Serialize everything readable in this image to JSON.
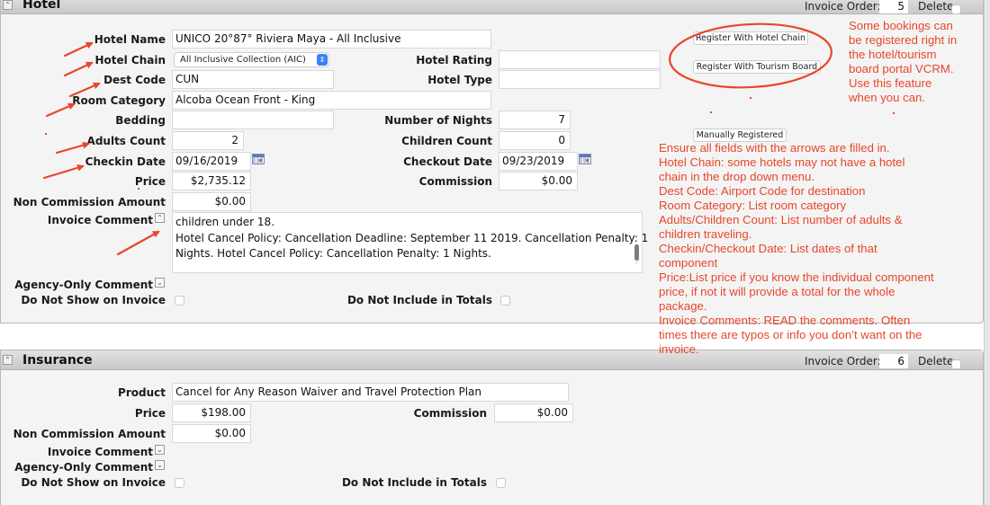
{
  "hotel": {
    "title": "Hotel",
    "invoice_order_label": "Invoice Order:",
    "invoice_order_value": "5",
    "delete_label": "Delete",
    "fields": {
      "hotel_name": {
        "label": "Hotel Name",
        "value": "UNICO 20°87° Riviera Maya - All Inclusive"
      },
      "hotel_chain": {
        "label": "Hotel Chain",
        "value": "All Inclusive Collection (AIC)"
      },
      "hotel_rating": {
        "label": "Hotel Rating",
        "value": ""
      },
      "dest_code": {
        "label": "Dest Code",
        "value": "CUN"
      },
      "hotel_type": {
        "label": "Hotel Type",
        "value": ""
      },
      "room_category": {
        "label": "Room Category",
        "value": "Alcoba Ocean Front - King"
      },
      "bedding": {
        "label": "Bedding",
        "value": ""
      },
      "number_of_nights": {
        "label": "Number of Nights",
        "value": "7"
      },
      "adults_count": {
        "label": "Adults Count",
        "value": "2"
      },
      "children_count": {
        "label": "Children Count",
        "value": "0"
      },
      "checkin_date": {
        "label": "Checkin Date",
        "value": "09/16/2019"
      },
      "checkout_date": {
        "label": "Checkout Date",
        "value": "09/23/2019"
      },
      "price": {
        "label": "Price",
        "value": "$2,735.12"
      },
      "commission": {
        "label": "Commission",
        "value": "$0.00"
      },
      "non_commission_amount": {
        "label": "Non Commission Amount",
        "value": "$0.00"
      },
      "invoice_comment": {
        "label": "Invoice Comment",
        "lines": [
          "children under 18.",
          "Hotel Cancel Policy: Cancellation Deadline: September 11 2019. Cancellation Penalty: 1",
          "Nights. Hotel Cancel Policy: Cancellation Penalty: 1 Nights."
        ]
      },
      "agency_only_comment": {
        "label": "Agency-Only Comment"
      },
      "do_not_show_on_invoice": {
        "label": "Do Not Show on Invoice",
        "checked": false
      },
      "do_not_include_in_totals": {
        "label": "Do Not Include in Totals",
        "checked": false
      }
    },
    "buttons": {
      "register_hotel_chain": "Register With Hotel Chain",
      "register_tourism_board": "Register With Tourism Board",
      "manually_registered": "Manually Registered"
    }
  },
  "insurance": {
    "title": "Insurance",
    "invoice_order_label": "Invoice Order:",
    "invoice_order_value": "6",
    "delete_label": "Delete",
    "fields": {
      "product": {
        "label": "Product",
        "value": "Cancel for Any Reason Waiver and Travel Protection Plan"
      },
      "price": {
        "label": "Price",
        "value": "$198.00"
      },
      "commission": {
        "label": "Commission",
        "value": "$0.00"
      },
      "non_commission_amount": {
        "label": "Non Commission Amount",
        "value": "$0.00"
      },
      "invoice_comment": {
        "label": "Invoice Comment"
      },
      "agency_only_comment": {
        "label": "Agency-Only Comment"
      },
      "do_not_show_on_invoice": {
        "label": "Do Not Show on Invoice",
        "checked": false
      },
      "do_not_include_in_totals": {
        "label": "Do Not Include in Totals",
        "checked": false
      }
    }
  },
  "annotations": {
    "color": "#e8462a",
    "registration_note": [
      "Some bookings can",
      "be registered right in",
      "the hotel/tourism",
      "board portal VCRM.",
      "Use this feature",
      "when you can."
    ],
    "instructions_note": [
      "Ensure all fields with the arrows are filled in.",
      "Hotel Chain: some hotels may not have a hotel",
      "chain in the drop down menu.",
      "Dest Code:  Airport Code for destination",
      "Room Category:  List room category",
      "Adults/Children Count:  List number of adults &",
      "children traveling.",
      "Checkin/Checkout Date:  List dates of that",
      "component",
      "Price:List price if you know the individual component",
      "price, if not it will provide a total for the whole",
      "package.",
      "Invoice Comments:  READ the comments.  Often",
      "times there are typos or info you don’t want on the",
      "invoice."
    ]
  },
  "icons": {
    "collapse": "⌃",
    "expand": "⌄",
    "select_chevron": "⇕"
  }
}
